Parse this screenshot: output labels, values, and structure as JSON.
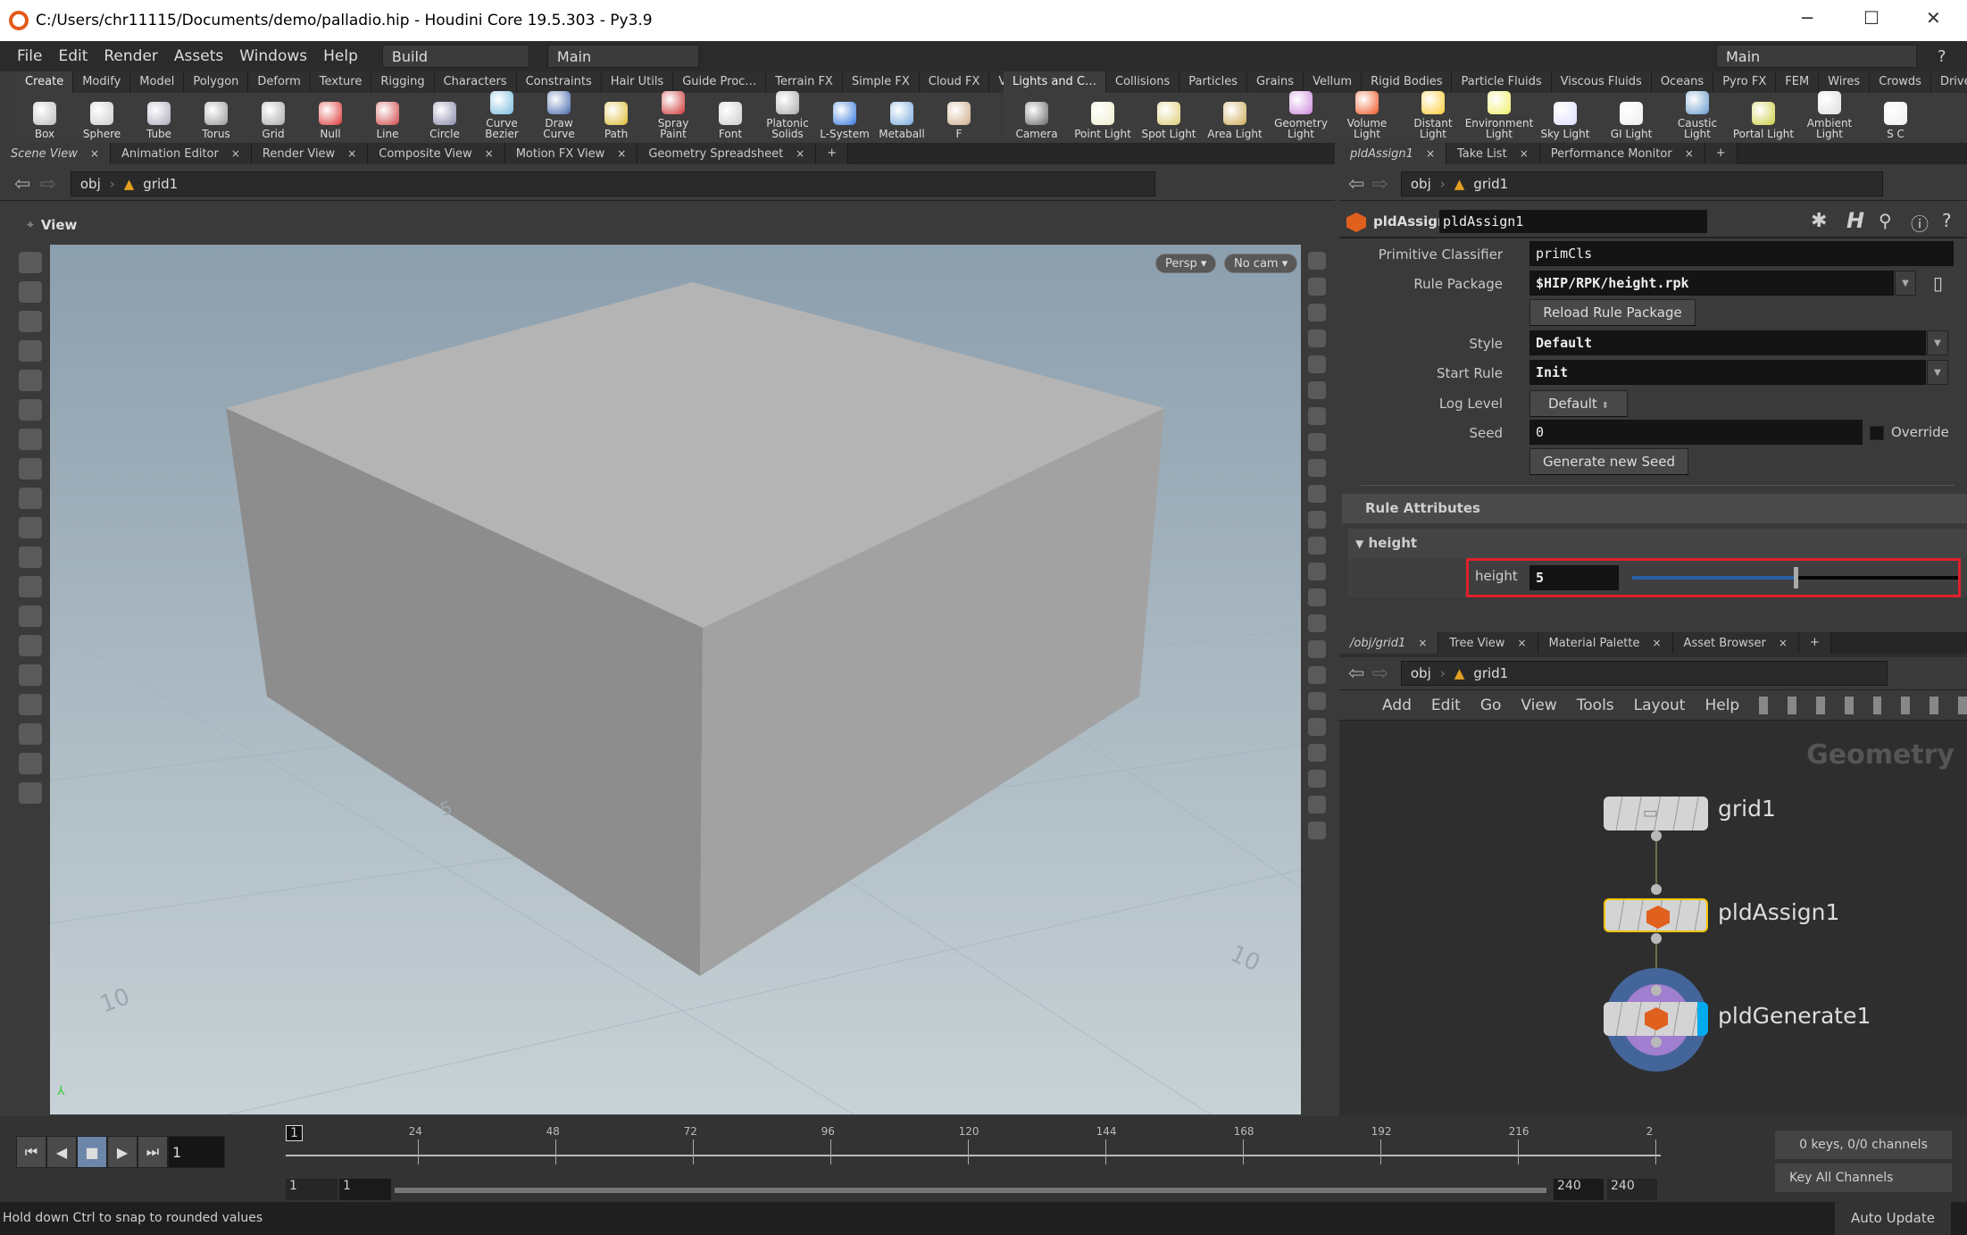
{
  "window": {
    "title": "C:/Users/chr11115/Documents/demo/palladio.hip - Houdini Core 19.5.303 - Py3.9",
    "minimize": "─",
    "maximize": "☐",
    "close": "✕"
  },
  "menu": [
    "File",
    "Edit",
    "Render",
    "Assets",
    "Windows",
    "Help"
  ],
  "desktop": {
    "build": "Build",
    "main": "Main",
    "right": "Main"
  },
  "shelf_left": {
    "tabs": [
      "Create",
      "Modify",
      "Model",
      "Polygon",
      "Deform",
      "Texture",
      "Rigging",
      "Characters",
      "Constraints",
      "Hair Utils",
      "Guide Proc…",
      "Terrain FX",
      "Simple FX",
      "Cloud FX",
      "Volume"
    ],
    "tools": [
      "Box",
      "Sphere",
      "Tube",
      "Torus",
      "Grid",
      "Null",
      "Line",
      "Circle",
      "Curve Bezier",
      "Draw Curve",
      "Path",
      "Spray Paint",
      "Font",
      "Platonic Solids",
      "L-System",
      "Metaball",
      "F"
    ]
  },
  "shelf_right": {
    "tabs": [
      "Lights and C…",
      "Collisions",
      "Particles",
      "Grains",
      "Vellum",
      "Rigid Bodies",
      "Particle Fluids",
      "Viscous Fluids",
      "Oceans",
      "Pyro FX",
      "FEM",
      "Wires",
      "Crowds",
      "Drive Simul…"
    ],
    "tools": [
      "Camera",
      "Point Light",
      "Spot Light",
      "Area Light",
      "Geometry Light",
      "Volume Light",
      "Distant Light",
      "Environment Light",
      "Sky Light",
      "GI Light",
      "Caustic Light",
      "Portal Light",
      "Ambient Light",
      "S C"
    ]
  },
  "left_pane": {
    "tabs": [
      "Scene View",
      "Animation Editor",
      "Render View",
      "Composite View",
      "Motion FX View",
      "Geometry Spreadsheet"
    ],
    "path": [
      "obj",
      "grid1"
    ],
    "view_label": "View",
    "persp": "Persp ▾",
    "cam": "No cam ▾",
    "grid_labels": [
      "10",
      "5",
      "10"
    ]
  },
  "params": {
    "tabs": [
      "pldAssign1",
      "Take List",
      "Performance Monitor"
    ],
    "path": [
      "obj",
      "grid1"
    ],
    "node_type": "pldAssign",
    "node_name": "pldAssign1",
    "primitive_classifier": {
      "label": "Primitive Classifier",
      "value": "primCls"
    },
    "rule_package": {
      "label": "Rule Package",
      "value": "$HIP/RPK/height.rpk"
    },
    "reload_button": "Reload Rule Package",
    "style": {
      "label": "Style",
      "value": "Default"
    },
    "start_rule": {
      "label": "Start Rule",
      "value": "Init"
    },
    "log_level": {
      "label": "Log Level",
      "value": "Default"
    },
    "seed": {
      "label": "Seed",
      "value": "0",
      "override": "Override"
    },
    "seed_button": "Generate new Seed",
    "rule_attributes": "Rule Attributes",
    "group": "height",
    "height": {
      "label": "height",
      "value": "5",
      "slider_fraction": 0.5
    },
    "highlight_color": "#e0202a"
  },
  "network": {
    "tabs": [
      "/obj/grid1",
      "Tree View",
      "Material Palette",
      "Asset Browser"
    ],
    "path": [
      "obj",
      "grid1"
    ],
    "menu": [
      "Add",
      "Edit",
      "Go",
      "View",
      "Tools",
      "Layout",
      "Help"
    ],
    "context": "Geometry",
    "nodes": [
      "grid1",
      "pldAssign1",
      "pldGenerate1"
    ]
  },
  "timeline": {
    "ticks": [
      "24",
      "48",
      "72",
      "96",
      "120",
      "144",
      "168",
      "192",
      "216",
      "2"
    ],
    "current_frame": "1",
    "frame_field": "1",
    "start": "1",
    "start2": "1",
    "end": "240",
    "end2": "240",
    "keys": "0 keys, 0/0 channels",
    "key_all": "Key All Channels"
  },
  "status": {
    "message": "Hold down Ctrl to snap to rounded values",
    "auto_update": "Auto Update"
  }
}
